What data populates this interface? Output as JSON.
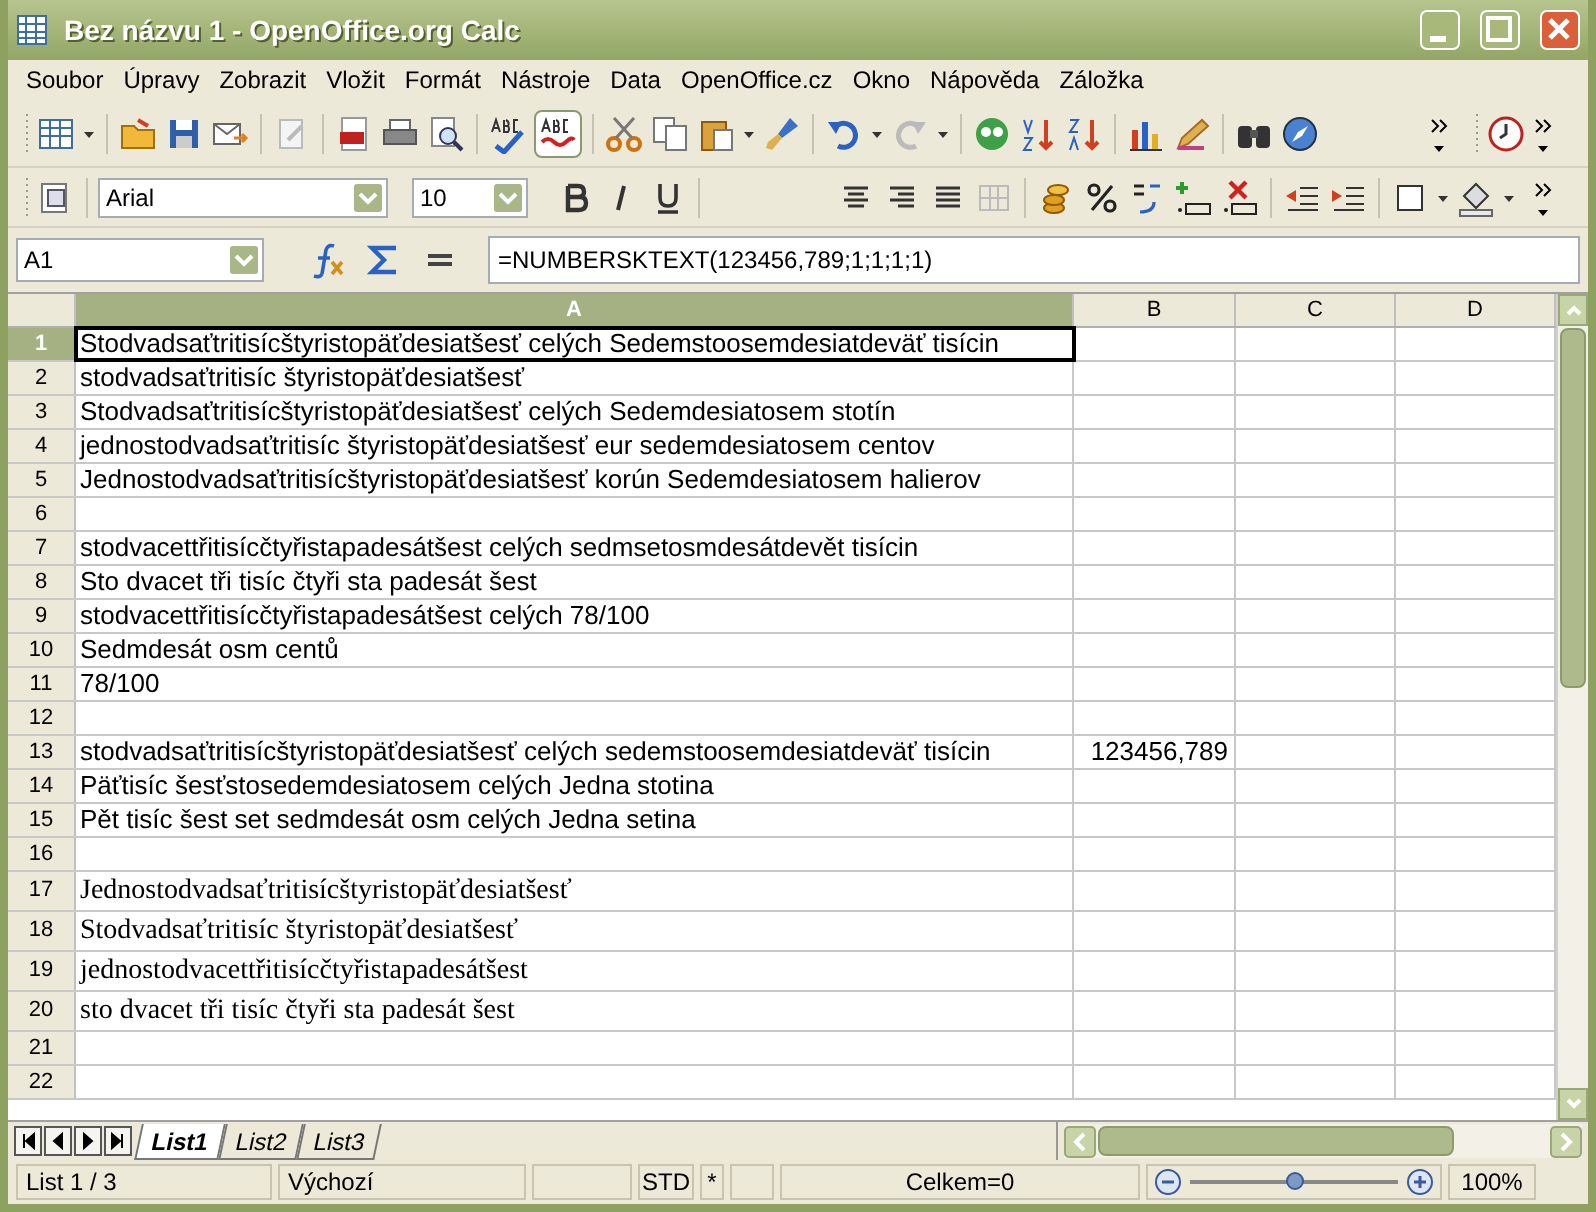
{
  "window": {
    "title": "Bez názvu 1 - OpenOffice.org Calc"
  },
  "menu": [
    "Soubor",
    "Úpravy",
    "Zobrazit",
    "Vložit",
    "Formát",
    "Nástroje",
    "Data",
    "OpenOffice.cz",
    "Okno",
    "Nápověda",
    "Záložka"
  ],
  "formatting": {
    "font": "Arial",
    "size": "10"
  },
  "formula_bar": {
    "name_box": "A1",
    "formula": "=NUMBERSKTEXT(123456,789;1;1;1;1)"
  },
  "columns": [
    {
      "label": "A",
      "selected": true
    },
    {
      "label": "B",
      "selected": false
    },
    {
      "label": "C",
      "selected": false
    },
    {
      "label": "D",
      "selected": false
    }
  ],
  "rows": [
    {
      "number": "1",
      "selected": true,
      "kind": "sans",
      "cells": [
        "Stodvadsaťtritisícštyristopäťdesiatšesť celých Sedemstoosemdesiatdeväť tisícin"
      ]
    },
    {
      "number": "2",
      "selected": false,
      "kind": "sans",
      "cells": [
        "stodvadsaťtritisíc štyristopäťdesiatšesť"
      ]
    },
    {
      "number": "3",
      "selected": false,
      "kind": "sans",
      "cells": [
        "Stodvadsaťtritisícštyristopäťdesiatšesť celých Sedemdesiatosem stotín"
      ]
    },
    {
      "number": "4",
      "selected": false,
      "kind": "sans",
      "cells": [
        "jednostodvadsaťtritisíc štyristopäťdesiatšesť eur sedemdesiatosem centov"
      ]
    },
    {
      "number": "5",
      "selected": false,
      "kind": "sans",
      "cells": [
        "Jednostodvadsaťtritisícštyristopäťdesiatšesť korún Sedemdesiatosem halierov"
      ]
    },
    {
      "number": "6",
      "selected": false,
      "kind": "sans",
      "cells": []
    },
    {
      "number": "7",
      "selected": false,
      "kind": "sans",
      "cells": [
        "stodvacettřitisícčtyřistapadesátšest celých sedmsetosmdesátdevět tisícin"
      ]
    },
    {
      "number": "8",
      "selected": false,
      "kind": "sans",
      "cells": [
        "Sto dvacet tři tisíc čtyři sta padesát šest"
      ]
    },
    {
      "number": "9",
      "selected": false,
      "kind": "sans",
      "cells": [
        "stodvacettřitisícčtyřistapadesátšest celých 78/100"
      ]
    },
    {
      "number": "10",
      "selected": false,
      "kind": "sans",
      "cells": [
        "Sedmdesát osm centů"
      ]
    },
    {
      "number": "11",
      "selected": false,
      "kind": "sans",
      "cells": [
        "78/100"
      ]
    },
    {
      "number": "12",
      "selected": false,
      "kind": "sans",
      "cells": []
    },
    {
      "number": "13",
      "selected": false,
      "kind": "sans",
      "cells": [
        "stodvadsaťtritisícštyristopäťdesiatšesť celých sedemstoosemdesiatdeväť tisícin",
        "123456,789"
      ]
    },
    {
      "number": "14",
      "selected": false,
      "kind": "sans",
      "cells": [
        "Päťtisíc šesťstosedemdesiatosem celých Jedna stotina"
      ]
    },
    {
      "number": "15",
      "selected": false,
      "kind": "sans",
      "cells": [
        "Pět tisíc šest set sedmdesát osm celých Jedna setina"
      ]
    },
    {
      "number": "16",
      "selected": false,
      "kind": "sans",
      "cells": []
    },
    {
      "number": "17",
      "selected": false,
      "kind": "serif",
      "cells": [
        "Jednostodvadsaťtritisícštyristopäťdesiatšesť"
      ]
    },
    {
      "number": "18",
      "selected": false,
      "kind": "serif",
      "cells": [
        "Stodvadsaťtritisíc štyristopäťdesiatšesť"
      ]
    },
    {
      "number": "19",
      "selected": false,
      "kind": "serif",
      "cells": [
        "jednostodvacettřitisícčtyřistapadesátšest"
      ]
    },
    {
      "number": "20",
      "selected": false,
      "kind": "serif",
      "cells": [
        "sto dvacet tři tisíc čtyři sta padesát šest"
      ]
    },
    {
      "number": "21",
      "selected": false,
      "kind": "sans",
      "cells": []
    },
    {
      "number": "22",
      "selected": false,
      "kind": "sans",
      "cells": []
    }
  ],
  "sheet_tabs": [
    {
      "label": "List1",
      "selected": true
    },
    {
      "label": "List2",
      "selected": false
    },
    {
      "label": "List3",
      "selected": false
    }
  ],
  "status_bar": [
    {
      "kind": "text",
      "text": "List 1 / 3"
    },
    {
      "kind": "text",
      "text": "Výchozí"
    },
    {
      "kind": "blank"
    },
    {
      "kind": "text",
      "text": "STD"
    },
    {
      "kind": "text",
      "text": "*"
    },
    {
      "kind": "blank"
    },
    {
      "kind": "sum",
      "text": "Celkem=0"
    },
    {
      "kind": "zoom",
      "level": 0.5
    },
    {
      "kind": "text",
      "text": "100%"
    }
  ]
}
